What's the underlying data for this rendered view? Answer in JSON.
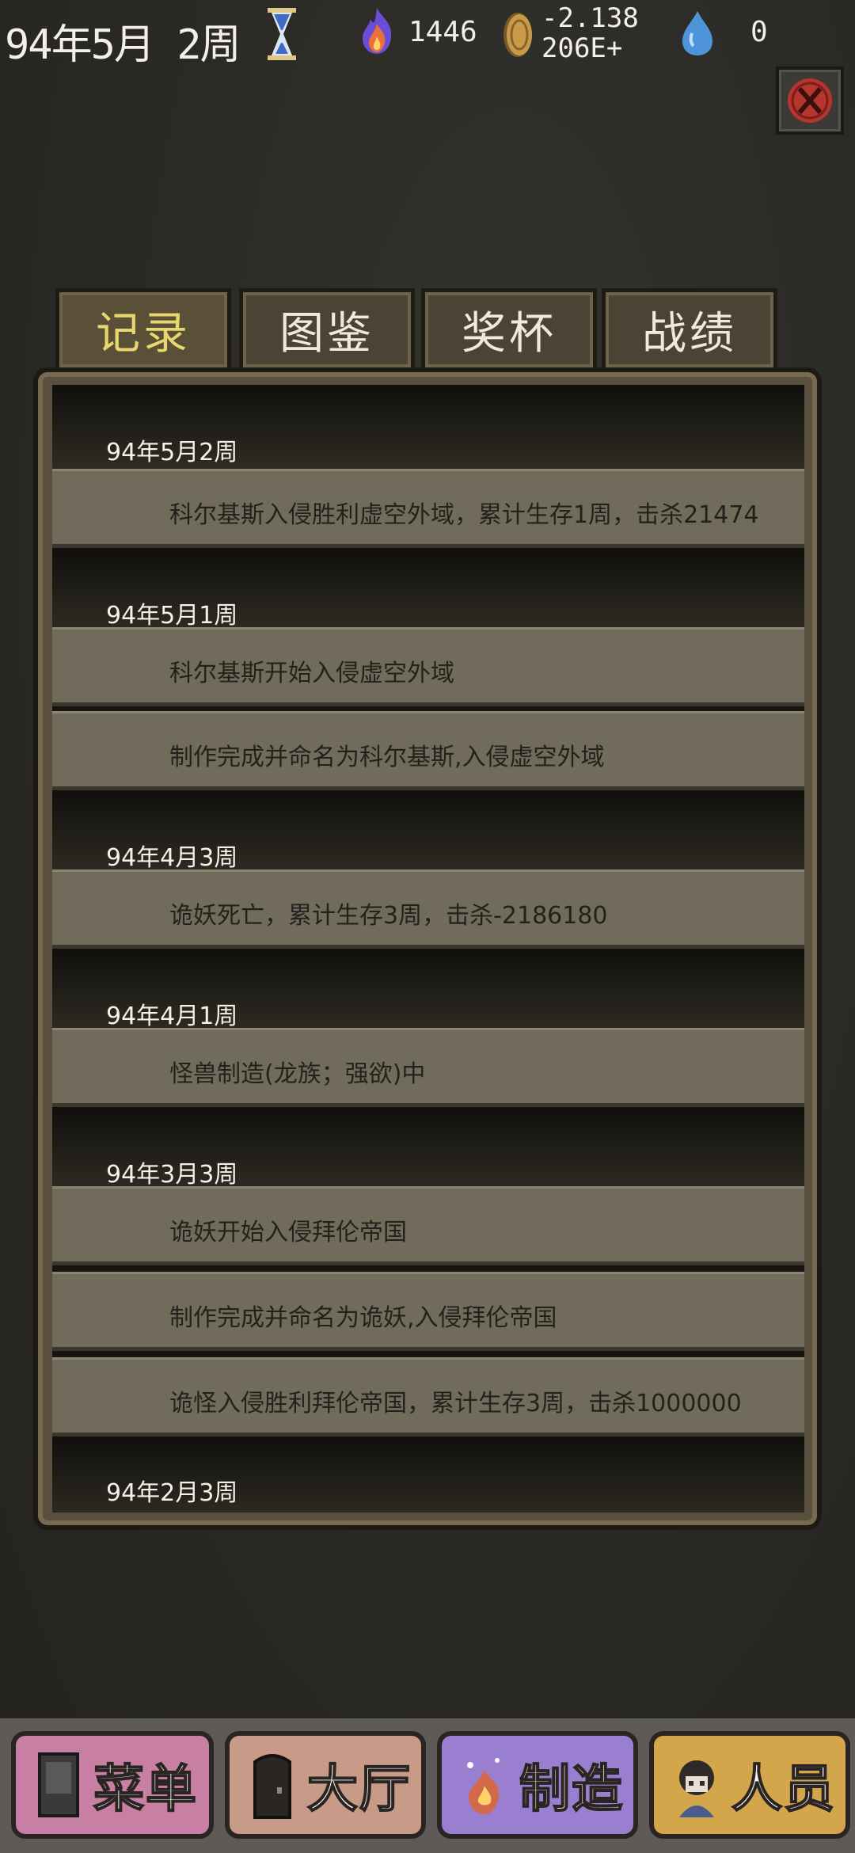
{
  "topbar": {
    "date": "94年5月 2周",
    "fire": "1446",
    "gold_line1": "-2.138",
    "gold_line2": "206E+",
    "water": "0"
  },
  "tabs": [
    {
      "label": "记录",
      "active": true
    },
    {
      "label": "图鉴",
      "active": false
    },
    {
      "label": "奖杯",
      "active": false
    },
    {
      "label": "战绩",
      "active": false
    }
  ],
  "records": [
    {
      "date": "94年5月2周",
      "entries": [
        "科尔基斯入侵胜利虚空外域，累计生存1周，击杀21474"
      ]
    },
    {
      "date": "94年5月1周",
      "entries": [
        "科尔基斯开始入侵虚空外域",
        "制作完成并命名为科尔基斯,入侵虚空外域"
      ]
    },
    {
      "date": "94年4月3周",
      "entries": [
        "诡妖死亡，累计生存3周，击杀-2186180"
      ]
    },
    {
      "date": "94年4月1周",
      "entries": [
        "怪兽制造(龙族；强欲)中"
      ]
    },
    {
      "date": "94年3月3周",
      "entries": [
        "诡妖开始入侵拜伦帝国",
        "制作完成并命名为诡妖,入侵拜伦帝国",
        "诡怪入侵胜利拜伦帝国，累计生存3周，击杀1000000"
      ]
    },
    {
      "date": "94年2月3周",
      "entries": []
    }
  ],
  "nav": [
    {
      "label": "菜单",
      "color": "#c87fa4",
      "icon": "book-icon"
    },
    {
      "label": "大厅",
      "color": "#c89a88",
      "icon": "door-icon"
    },
    {
      "label": "制造",
      "color": "#9a7fd0",
      "icon": "cauldron-icon"
    },
    {
      "label": "人员",
      "color": "#d4a64c",
      "icon": "character-icon"
    }
  ]
}
